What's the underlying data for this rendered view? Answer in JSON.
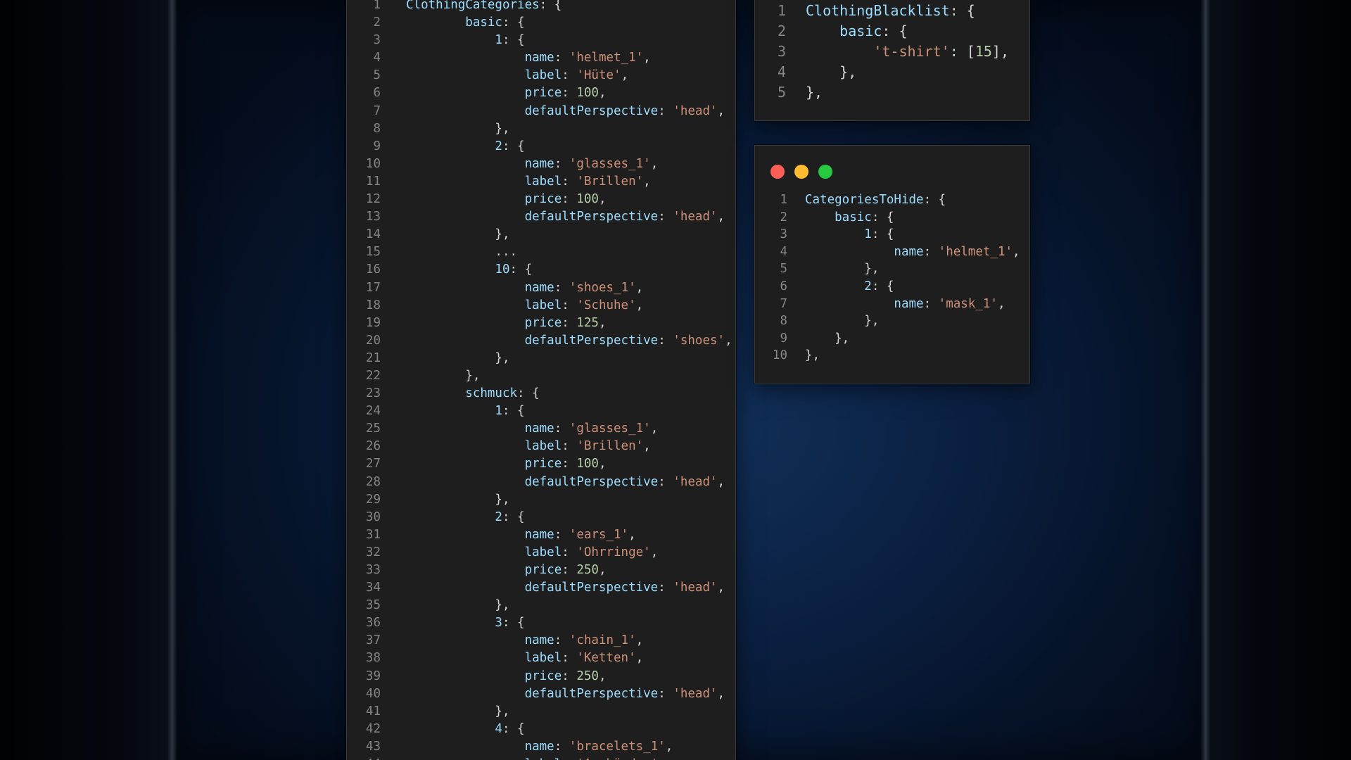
{
  "colors": {
    "key": "#9cdcfe",
    "string": "#ce9178",
    "number": "#b5cea8",
    "punctuation": "#d4d4d4",
    "line_number": "#858585",
    "editor_bg": "#1e1e1e",
    "close": "#ff5f57",
    "minimize": "#febc2e",
    "maximize": "#28c840"
  },
  "window_controls": {
    "close": "close-icon",
    "minimize": "minimize-icon",
    "maximize": "maximize-icon"
  },
  "editors": [
    {
      "id": "clothing-categories",
      "lines": [
        {
          "n": "1",
          "t": [
            [
              "ClothingCategories",
              "key"
            ],
            [
              ": {",
              "punc"
            ]
          ]
        },
        {
          "n": "2",
          "t": [
            [
              "        basic",
              "key"
            ],
            [
              ": {",
              "punc"
            ]
          ]
        },
        {
          "n": "3",
          "t": [
            [
              "            1",
              "key"
            ],
            [
              ": {",
              "punc"
            ]
          ]
        },
        {
          "n": "4",
          "t": [
            [
              "                name",
              "key"
            ],
            [
              ": ",
              "punc"
            ],
            [
              "'helmet_1'",
              "str"
            ],
            [
              ",",
              "punc"
            ]
          ]
        },
        {
          "n": "5",
          "t": [
            [
              "                label",
              "key"
            ],
            [
              ": ",
              "punc"
            ],
            [
              "'Hüte'",
              "str"
            ],
            [
              ",",
              "punc"
            ]
          ]
        },
        {
          "n": "6",
          "t": [
            [
              "                price",
              "key"
            ],
            [
              ": ",
              "punc"
            ],
            [
              "100",
              "num"
            ],
            [
              ",",
              "punc"
            ]
          ]
        },
        {
          "n": "7",
          "t": [
            [
              "                defaultPerspective",
              "key"
            ],
            [
              ": ",
              "punc"
            ],
            [
              "'head'",
              "str"
            ],
            [
              ",",
              "punc"
            ]
          ]
        },
        {
          "n": "8",
          "t": [
            [
              "            },",
              "punc"
            ]
          ]
        },
        {
          "n": "9",
          "t": [
            [
              "            2",
              "key"
            ],
            [
              ": {",
              "punc"
            ]
          ]
        },
        {
          "n": "10",
          "t": [
            [
              "                name",
              "key"
            ],
            [
              ": ",
              "punc"
            ],
            [
              "'glasses_1'",
              "str"
            ],
            [
              ",",
              "punc"
            ]
          ]
        },
        {
          "n": "11",
          "t": [
            [
              "                label",
              "key"
            ],
            [
              ": ",
              "punc"
            ],
            [
              "'Brillen'",
              "str"
            ],
            [
              ",",
              "punc"
            ]
          ]
        },
        {
          "n": "12",
          "t": [
            [
              "                price",
              "key"
            ],
            [
              ": ",
              "punc"
            ],
            [
              "100",
              "num"
            ],
            [
              ",",
              "punc"
            ]
          ]
        },
        {
          "n": "13",
          "t": [
            [
              "                defaultPerspective",
              "key"
            ],
            [
              ": ",
              "punc"
            ],
            [
              "'head'",
              "str"
            ],
            [
              ",",
              "punc"
            ]
          ]
        },
        {
          "n": "14",
          "t": [
            [
              "            },",
              "punc"
            ]
          ]
        },
        {
          "n": "15",
          "t": [
            [
              "            ...",
              "punc"
            ]
          ]
        },
        {
          "n": "16",
          "t": [
            [
              "            10",
              "key"
            ],
            [
              ": {",
              "punc"
            ]
          ]
        },
        {
          "n": "17",
          "t": [
            [
              "                name",
              "key"
            ],
            [
              ": ",
              "punc"
            ],
            [
              "'shoes_1'",
              "str"
            ],
            [
              ",",
              "punc"
            ]
          ]
        },
        {
          "n": "18",
          "t": [
            [
              "                label",
              "key"
            ],
            [
              ": ",
              "punc"
            ],
            [
              "'Schuhe'",
              "str"
            ],
            [
              ",",
              "punc"
            ]
          ]
        },
        {
          "n": "19",
          "t": [
            [
              "                price",
              "key"
            ],
            [
              ": ",
              "punc"
            ],
            [
              "125",
              "num"
            ],
            [
              ",",
              "punc"
            ]
          ]
        },
        {
          "n": "20",
          "t": [
            [
              "                defaultPerspective",
              "key"
            ],
            [
              ": ",
              "punc"
            ],
            [
              "'shoes'",
              "str"
            ],
            [
              ",",
              "punc"
            ]
          ]
        },
        {
          "n": "21",
          "t": [
            [
              "            },",
              "punc"
            ]
          ]
        },
        {
          "n": "22",
          "t": [
            [
              "        },",
              "punc"
            ]
          ]
        },
        {
          "n": "23",
          "t": [
            [
              "        schmuck",
              "key"
            ],
            [
              ": {",
              "punc"
            ]
          ]
        },
        {
          "n": "24",
          "t": [
            [
              "            1",
              "key"
            ],
            [
              ": {",
              "punc"
            ]
          ]
        },
        {
          "n": "25",
          "t": [
            [
              "                name",
              "key"
            ],
            [
              ": ",
              "punc"
            ],
            [
              "'glasses_1'",
              "str"
            ],
            [
              ",",
              "punc"
            ]
          ]
        },
        {
          "n": "26",
          "t": [
            [
              "                label",
              "key"
            ],
            [
              ": ",
              "punc"
            ],
            [
              "'Brillen'",
              "str"
            ],
            [
              ",",
              "punc"
            ]
          ]
        },
        {
          "n": "27",
          "t": [
            [
              "                price",
              "key"
            ],
            [
              ": ",
              "punc"
            ],
            [
              "100",
              "num"
            ],
            [
              ",",
              "punc"
            ]
          ]
        },
        {
          "n": "28",
          "t": [
            [
              "                defaultPerspective",
              "key"
            ],
            [
              ": ",
              "punc"
            ],
            [
              "'head'",
              "str"
            ],
            [
              ",",
              "punc"
            ]
          ]
        },
        {
          "n": "29",
          "t": [
            [
              "            },",
              "punc"
            ]
          ]
        },
        {
          "n": "30",
          "t": [
            [
              "            2",
              "key"
            ],
            [
              ": {",
              "punc"
            ]
          ]
        },
        {
          "n": "31",
          "t": [
            [
              "                name",
              "key"
            ],
            [
              ": ",
              "punc"
            ],
            [
              "'ears_1'",
              "str"
            ],
            [
              ",",
              "punc"
            ]
          ]
        },
        {
          "n": "32",
          "t": [
            [
              "                label",
              "key"
            ],
            [
              ": ",
              "punc"
            ],
            [
              "'Ohrringe'",
              "str"
            ],
            [
              ",",
              "punc"
            ]
          ]
        },
        {
          "n": "33",
          "t": [
            [
              "                price",
              "key"
            ],
            [
              ": ",
              "punc"
            ],
            [
              "250",
              "num"
            ],
            [
              ",",
              "punc"
            ]
          ]
        },
        {
          "n": "34",
          "t": [
            [
              "                defaultPerspective",
              "key"
            ],
            [
              ": ",
              "punc"
            ],
            [
              "'head'",
              "str"
            ],
            [
              ",",
              "punc"
            ]
          ]
        },
        {
          "n": "35",
          "t": [
            [
              "            },",
              "punc"
            ]
          ]
        },
        {
          "n": "36",
          "t": [
            [
              "            3",
              "key"
            ],
            [
              ": {",
              "punc"
            ]
          ]
        },
        {
          "n": "37",
          "t": [
            [
              "                name",
              "key"
            ],
            [
              ": ",
              "punc"
            ],
            [
              "'chain_1'",
              "str"
            ],
            [
              ",",
              "punc"
            ]
          ]
        },
        {
          "n": "38",
          "t": [
            [
              "                label",
              "key"
            ],
            [
              ": ",
              "punc"
            ],
            [
              "'Ketten'",
              "str"
            ],
            [
              ",",
              "punc"
            ]
          ]
        },
        {
          "n": "39",
          "t": [
            [
              "                price",
              "key"
            ],
            [
              ": ",
              "punc"
            ],
            [
              "250",
              "num"
            ],
            [
              ",",
              "punc"
            ]
          ]
        },
        {
          "n": "40",
          "t": [
            [
              "                defaultPerspective",
              "key"
            ],
            [
              ": ",
              "punc"
            ],
            [
              "'head'",
              "str"
            ],
            [
              ",",
              "punc"
            ]
          ]
        },
        {
          "n": "41",
          "t": [
            [
              "            },",
              "punc"
            ]
          ]
        },
        {
          "n": "42",
          "t": [
            [
              "            4",
              "key"
            ],
            [
              ": {",
              "punc"
            ]
          ]
        },
        {
          "n": "43",
          "t": [
            [
              "                name",
              "key"
            ],
            [
              ": ",
              "punc"
            ],
            [
              "'bracelets_1'",
              "str"
            ],
            [
              ",",
              "punc"
            ]
          ]
        },
        {
          "n": "44",
          "t": [
            [
              "                label",
              "key"
            ],
            [
              ": ",
              "punc"
            ],
            [
              "'Armbänder'",
              "str"
            ],
            [
              ",",
              "punc"
            ]
          ]
        }
      ]
    },
    {
      "id": "clothing-blacklist",
      "lines": [
        {
          "n": "1",
          "t": [
            [
              "ClothingBlacklist",
              "key"
            ],
            [
              ": {",
              "punc"
            ]
          ]
        },
        {
          "n": "2",
          "t": [
            [
              "    basic",
              "key"
            ],
            [
              ": {",
              "punc"
            ]
          ]
        },
        {
          "n": "3",
          "t": [
            [
              "        ",
              "punc"
            ],
            [
              "'t-shirt'",
              "str"
            ],
            [
              ": [",
              "punc"
            ],
            [
              "15",
              "num"
            ],
            [
              "],",
              "punc"
            ]
          ]
        },
        {
          "n": "4",
          "t": [
            [
              "    },",
              "punc"
            ]
          ]
        },
        {
          "n": "5",
          "t": [
            [
              "},",
              "punc"
            ]
          ]
        }
      ]
    },
    {
      "id": "categories-to-hide",
      "lines": [
        {
          "n": "1",
          "t": [
            [
              "CategoriesToHide",
              "key"
            ],
            [
              ": {",
              "punc"
            ]
          ]
        },
        {
          "n": "2",
          "t": [
            [
              "    basic",
              "key"
            ],
            [
              ": {",
              "punc"
            ]
          ]
        },
        {
          "n": "3",
          "t": [
            [
              "        1",
              "key"
            ],
            [
              ": {",
              "punc"
            ]
          ]
        },
        {
          "n": "4",
          "t": [
            [
              "            name",
              "key"
            ],
            [
              ": ",
              "punc"
            ],
            [
              "'helmet_1'",
              "str"
            ],
            [
              ",",
              "punc"
            ]
          ]
        },
        {
          "n": "5",
          "t": [
            [
              "        },",
              "punc"
            ]
          ]
        },
        {
          "n": "6",
          "t": [
            [
              "        2",
              "key"
            ],
            [
              ": {",
              "punc"
            ]
          ]
        },
        {
          "n": "7",
          "t": [
            [
              "            name",
              "key"
            ],
            [
              ": ",
              "punc"
            ],
            [
              "'mask_1'",
              "str"
            ],
            [
              ",",
              "punc"
            ]
          ]
        },
        {
          "n": "8",
          "t": [
            [
              "        },",
              "punc"
            ]
          ]
        },
        {
          "n": "9",
          "t": [
            [
              "    },",
              "punc"
            ]
          ]
        },
        {
          "n": "10",
          "t": [
            [
              "},",
              "punc"
            ]
          ]
        }
      ]
    }
  ]
}
